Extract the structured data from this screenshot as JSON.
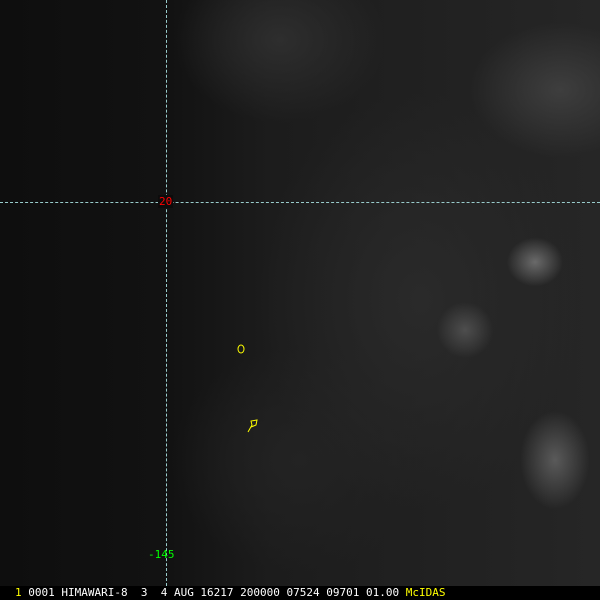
{
  "grid": {
    "latitude_label": "20",
    "longitude_label": "-145",
    "line_color": "#99cccc"
  },
  "status_bar": {
    "frame_number": "1",
    "text": "0001 HIMAWARI-8  3  4 AUG 16217 200000 07524 09701 01.00",
    "brand": "McIDAS"
  },
  "colors": {
    "latitude_label": "#ff0000",
    "longitude_label": "#00ff00",
    "coastline": "#ffff00",
    "brand": "#ffff00"
  }
}
